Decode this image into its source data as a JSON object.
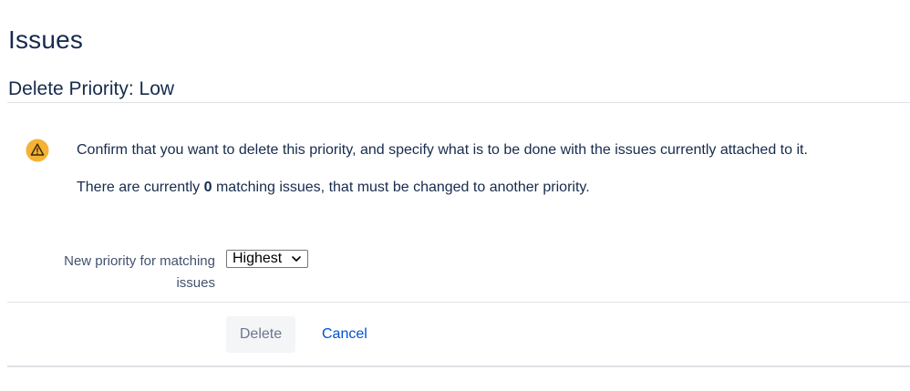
{
  "page": {
    "title": "Issues"
  },
  "section": {
    "title": "Delete Priority: Low"
  },
  "warning": {
    "icon": "warning-icon",
    "icon_color": "#f5b236",
    "line1": "Confirm that you want to delete this priority, and specify what is to be done with the issues currently attached to it.",
    "line2_prefix": "There are currently ",
    "line2_count": "0",
    "line2_suffix": " matching issues, that must be changed to another priority."
  },
  "form": {
    "new_priority_label_line1": "New priority for matching",
    "new_priority_label_line2": "issues",
    "selected_priority": "Highest"
  },
  "actions": {
    "delete_label": "Delete",
    "cancel_label": "Cancel",
    "link_color": "#0052cc"
  }
}
